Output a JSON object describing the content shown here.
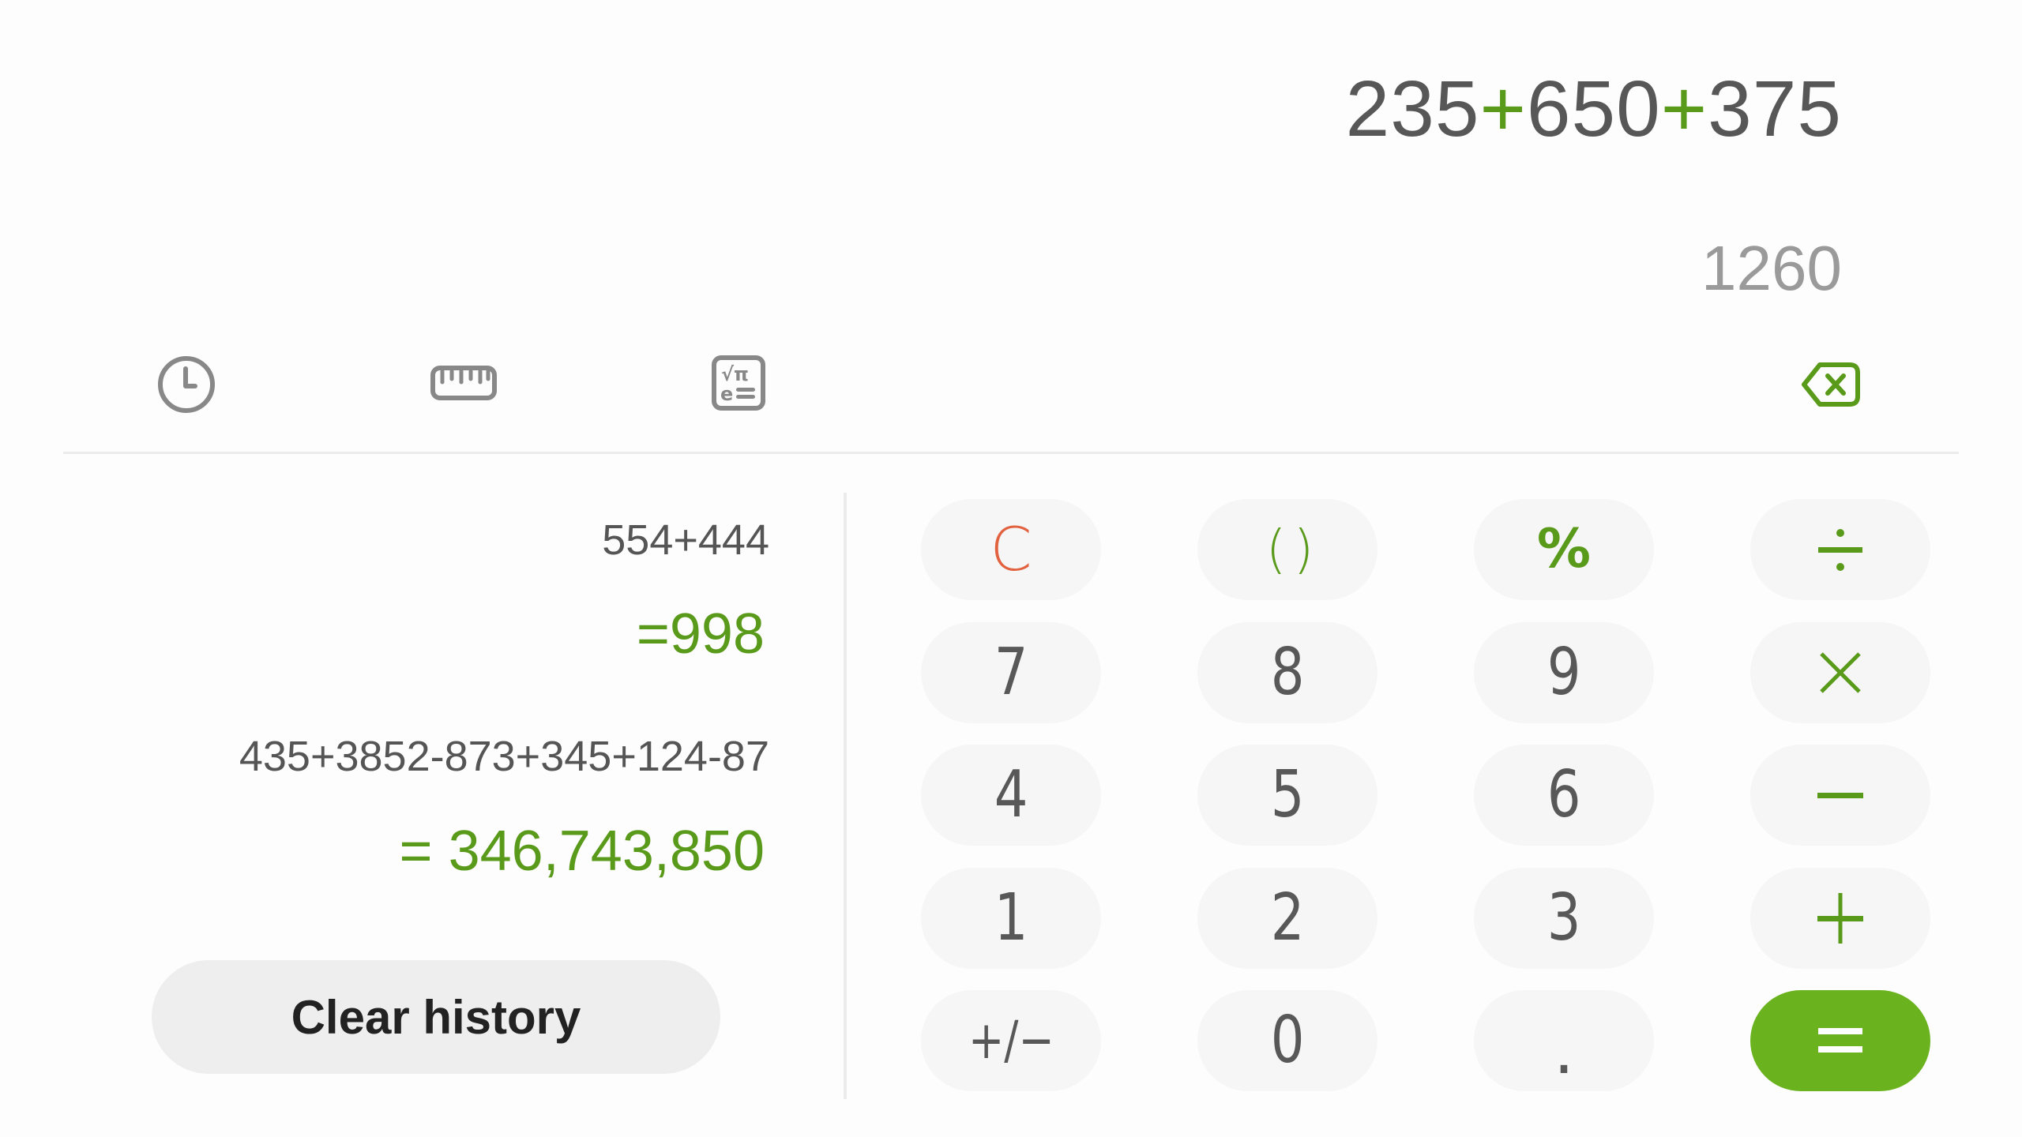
{
  "display": {
    "expression": {
      "parts": [
        {
          "text": "235",
          "type": "number"
        },
        {
          "text": "+",
          "type": "operator"
        },
        {
          "text": "650",
          "type": "number"
        },
        {
          "text": "+",
          "type": "operator"
        },
        {
          "text": "375",
          "type": "number"
        }
      ]
    },
    "preview_result": "1260"
  },
  "toolbar": {
    "history_icon": "clock-icon",
    "converter_icon": "ruler-icon",
    "scientific_icon": "scientific-calculator-icon",
    "backspace_icon": "backspace-icon"
  },
  "history": {
    "items": [
      {
        "expression": "554+444",
        "result": "=998"
      },
      {
        "expression": "435+3852-873+345+124-87",
        "result": "= 346,743,850"
      }
    ],
    "clear_label": "Clear history"
  },
  "keypad": {
    "rows": [
      [
        {
          "label": "C",
          "name": "clear",
          "style": "red"
        },
        {
          "label": "( )",
          "name": "parentheses",
          "style": "green"
        },
        {
          "label": "%",
          "name": "percent",
          "style": "green"
        },
        {
          "label": "÷",
          "name": "divide",
          "style": "green",
          "icon": "divide-icon"
        }
      ],
      [
        {
          "label": "7",
          "name": "7",
          "style": "num"
        },
        {
          "label": "8",
          "name": "8",
          "style": "num"
        },
        {
          "label": "9",
          "name": "9",
          "style": "num"
        },
        {
          "label": "×",
          "name": "multiply",
          "style": "green",
          "icon": "multiply-icon"
        }
      ],
      [
        {
          "label": "4",
          "name": "4",
          "style": "num"
        },
        {
          "label": "5",
          "name": "5",
          "style": "num"
        },
        {
          "label": "6",
          "name": "6",
          "style": "num"
        },
        {
          "label": "−",
          "name": "subtract",
          "style": "green",
          "icon": "minus-icon"
        }
      ],
      [
        {
          "label": "1",
          "name": "1",
          "style": "num"
        },
        {
          "label": "2",
          "name": "2",
          "style": "num"
        },
        {
          "label": "3",
          "name": "3",
          "style": "num"
        },
        {
          "label": "+",
          "name": "add",
          "style": "green",
          "icon": "plus-icon"
        }
      ],
      [
        {
          "label": "+/−",
          "name": "plus-minus",
          "style": "num"
        },
        {
          "label": "0",
          "name": "0",
          "style": "num"
        },
        {
          "label": ".",
          "name": "decimal",
          "style": "num"
        },
        {
          "label": "=",
          "name": "equals",
          "style": "equals",
          "icon": "equals-icon"
        }
      ]
    ]
  },
  "colors": {
    "accent_green": "#5a9a1a",
    "equals_green": "#6ab31f",
    "clear_red": "#e2623f",
    "key_background": "#f6f6f6",
    "text_dark": "#555555",
    "preview_gray": "#9a9a9a"
  }
}
